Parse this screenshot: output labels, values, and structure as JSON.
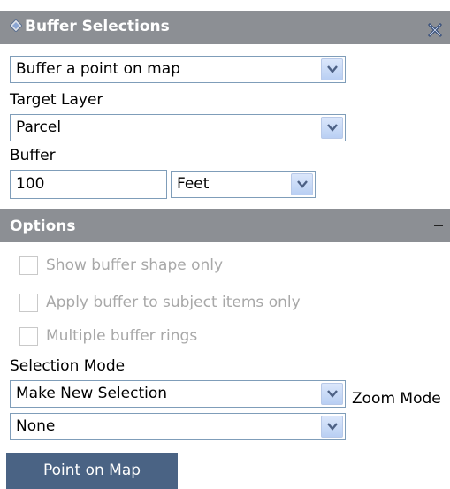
{
  "top_strip": {
    "text": ""
  },
  "panel": {
    "title": "Buffer Selections"
  },
  "buffer_method": {
    "value": "Buffer a point on map"
  },
  "target_layer": {
    "label": "Target Layer",
    "value": "Parcel"
  },
  "buffer": {
    "label": "Buffer",
    "distance_value": "100",
    "unit_value": "Feet"
  },
  "options": {
    "title": "Options",
    "checkboxes": [
      {
        "label": "Show buffer shape only",
        "checked": false,
        "enabled": false
      },
      {
        "label": "Apply buffer to subject items only",
        "checked": false,
        "enabled": false
      },
      {
        "label": "Multiple buffer rings",
        "checked": false,
        "enabled": false
      }
    ]
  },
  "selection_mode": {
    "label": "Selection Mode",
    "value": "Make New Selection"
  },
  "zoom_mode": {
    "label": "Zoom Mode",
    "value": "None"
  },
  "action": {
    "label": "Point on Map"
  },
  "colors": {
    "header_bg": "#8c8f94",
    "action_button_bg": "#4a6384",
    "field_border": "#7f9db9"
  }
}
